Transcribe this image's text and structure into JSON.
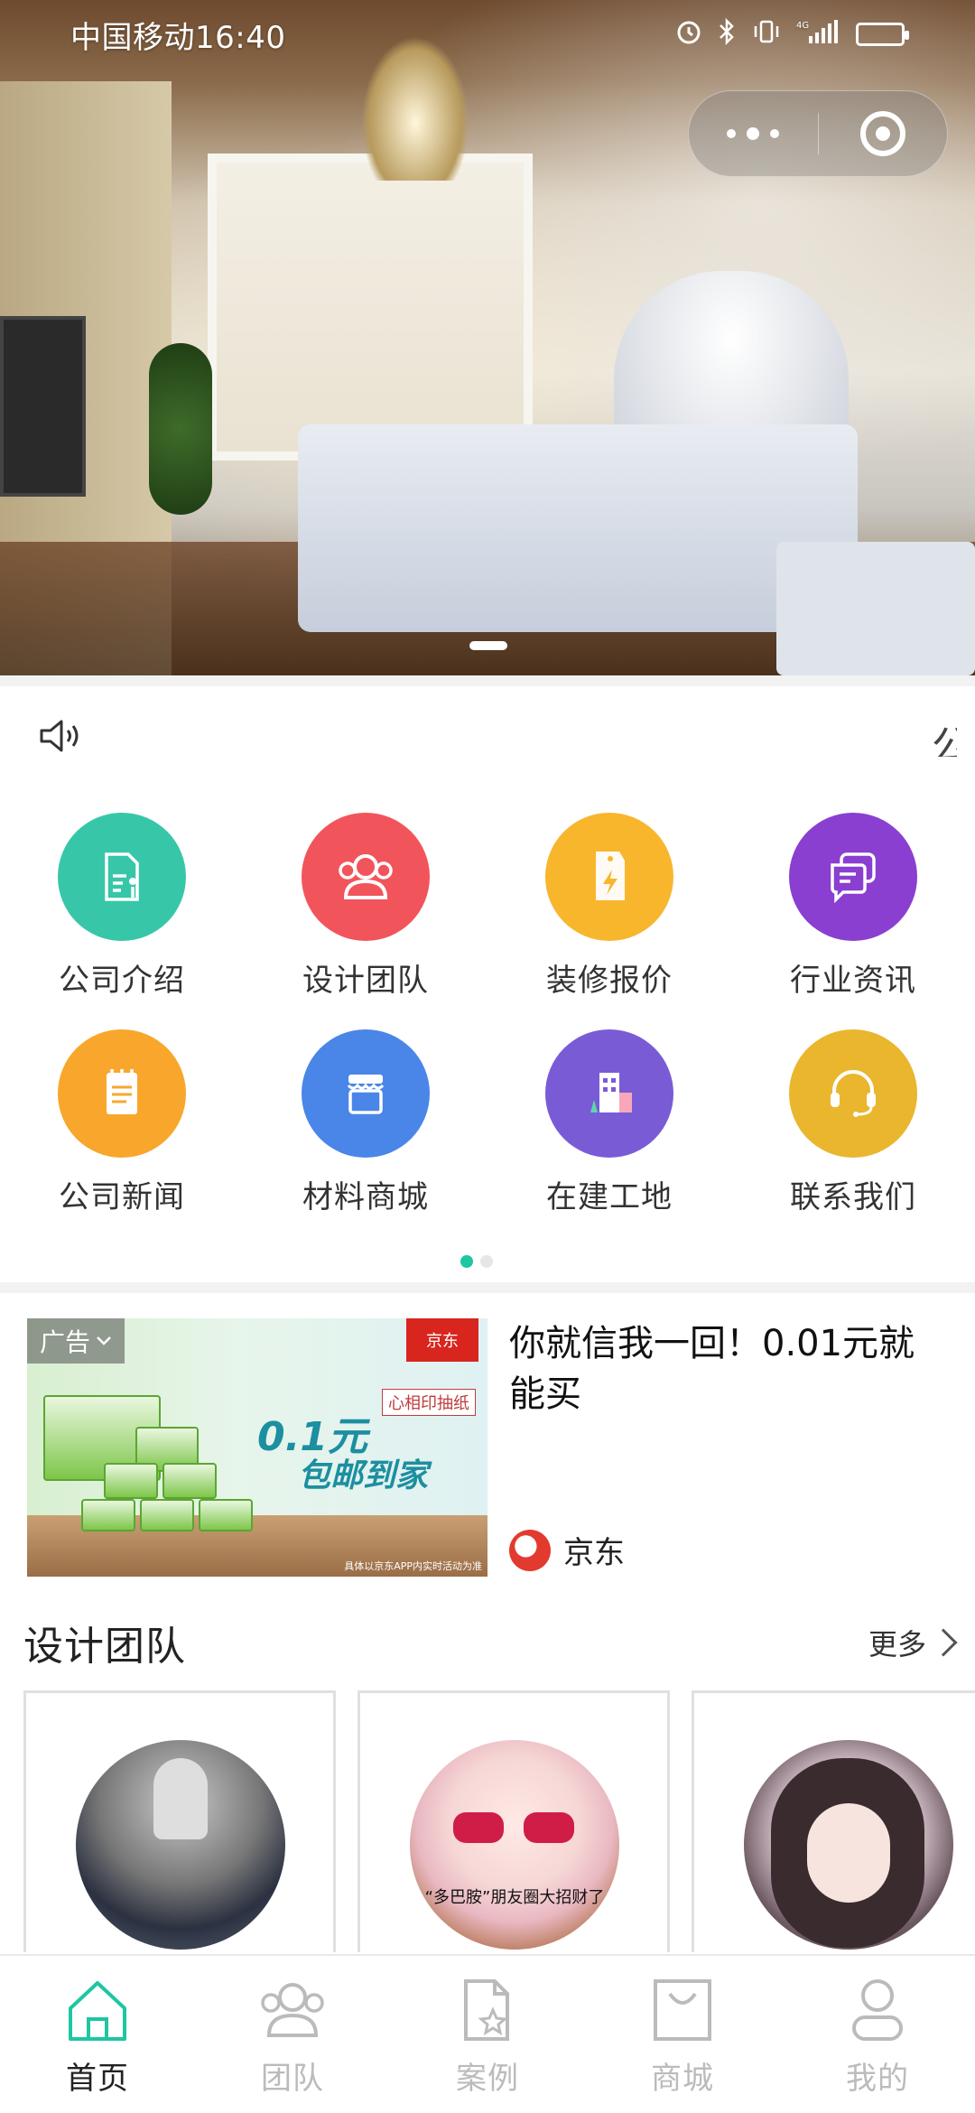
{
  "status_bar": {
    "carrier_time": "中国移动16:40",
    "icons": [
      "alarm-icon",
      "bluetooth-icon",
      "vibrate-icon",
      "signal-4g-icon",
      "battery-icon"
    ],
    "network": "4G"
  },
  "capsule": {
    "more_icon": "more-dots-icon",
    "close_icon": "target-close-icon"
  },
  "banner": {
    "image": "luxury-bedroom-photo",
    "page_count": 1
  },
  "notice": {
    "icon": "speaker-icon",
    "trailing_text": "公"
  },
  "grid": {
    "items": [
      {
        "label": "公司介绍",
        "icon": "document-icon",
        "color": "#38c6a8"
      },
      {
        "label": "设计团队",
        "icon": "people-icon",
        "color": "#f2545b"
      },
      {
        "label": "装修报价",
        "icon": "price-tag-icon",
        "color": "#f8b62d"
      },
      {
        "label": "行业资讯",
        "icon": "chat-icon",
        "color": "#8a3fd1"
      },
      {
        "label": "公司新闻",
        "icon": "notepad-icon",
        "color": "#f8a72c"
      },
      {
        "label": "材料商城",
        "icon": "shop-icon",
        "color": "#4a86e8"
      },
      {
        "label": "在建工地",
        "icon": "building-icon",
        "color": "#7a5bd6"
      },
      {
        "label": "联系我们",
        "icon": "headset-icon",
        "color": "#e9b62e"
      }
    ],
    "pages": 2,
    "active_page": 1
  },
  "ad": {
    "badge": "广告",
    "title": "你就信我一回！0.01元就能买",
    "brand": "京东",
    "image": {
      "promo_price": "0.1元",
      "promo_text": "包邮到家",
      "product_tag": "心相印抽纸",
      "logo_text": "京东",
      "fine_print": "具体以京东APP内实时活动为准"
    },
    "accent": "#d8261e"
  },
  "team_section": {
    "title": "设计团队",
    "more": "更多",
    "members": [
      {
        "avatar": "cat-tiger-reflection-avatar"
      },
      {
        "avatar": "cartoon-girl-sunglasses-avatar",
        "caption": "“多巴胺”朋友圈大招财了"
      },
      {
        "avatar": "anime-girl-avatar"
      }
    ]
  },
  "tabbar": {
    "active_color": "#1ec6a2",
    "inactive_color": "#bbbbbb",
    "tabs": [
      {
        "label": "首页",
        "icon": "home-icon",
        "active": true
      },
      {
        "label": "团队",
        "icon": "team-icon",
        "active": false
      },
      {
        "label": "案例",
        "icon": "case-icon",
        "active": false
      },
      {
        "label": "商城",
        "icon": "bag-icon",
        "active": false
      },
      {
        "label": "我的",
        "icon": "user-icon",
        "active": false
      }
    ]
  }
}
